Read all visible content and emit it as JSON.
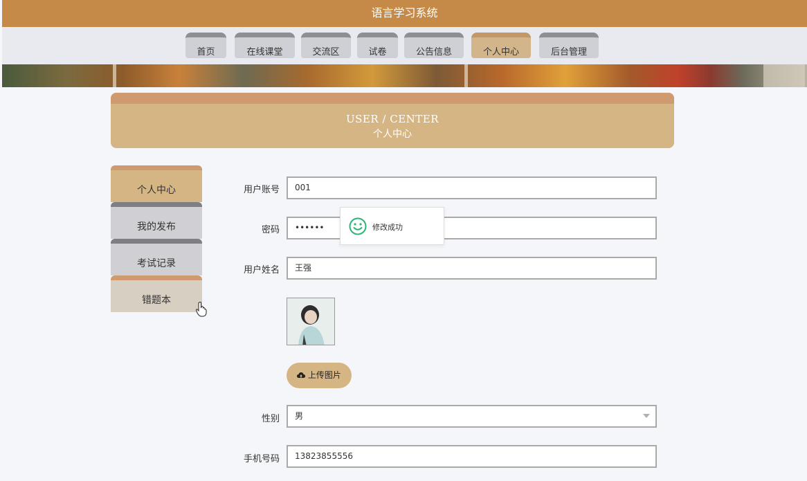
{
  "app": {
    "title": "语言学习系统"
  },
  "nav": {
    "items": [
      {
        "label": "首页"
      },
      {
        "label": "在线课堂"
      },
      {
        "label": "交流区"
      },
      {
        "label": "试卷"
      },
      {
        "label": "公告信息"
      },
      {
        "label": "个人中心"
      },
      {
        "label": "后台管理"
      }
    ],
    "active": "个人中心"
  },
  "header": {
    "en_title": "USER / CENTER",
    "cn_title": "个人中心"
  },
  "sidebar": {
    "items": [
      {
        "label": "个人中心"
      },
      {
        "label": "我的发布"
      },
      {
        "label": "考试记录"
      },
      {
        "label": "错题本"
      }
    ]
  },
  "form": {
    "username": {
      "label": "用户账号",
      "value": "001"
    },
    "password": {
      "label": "密码",
      "value": "••••••"
    },
    "realname": {
      "label": "用户姓名",
      "value": "王强"
    },
    "upload": {
      "label": "上传图片"
    },
    "gender": {
      "label": "性别",
      "value": "男"
    },
    "phone": {
      "label": "手机号码",
      "value": "13823855556"
    }
  },
  "toast": {
    "message": "修改成功"
  },
  "colors": {
    "brand": "#c58a47",
    "accent": "#d6b584",
    "toast_icon": "#2bb673"
  }
}
